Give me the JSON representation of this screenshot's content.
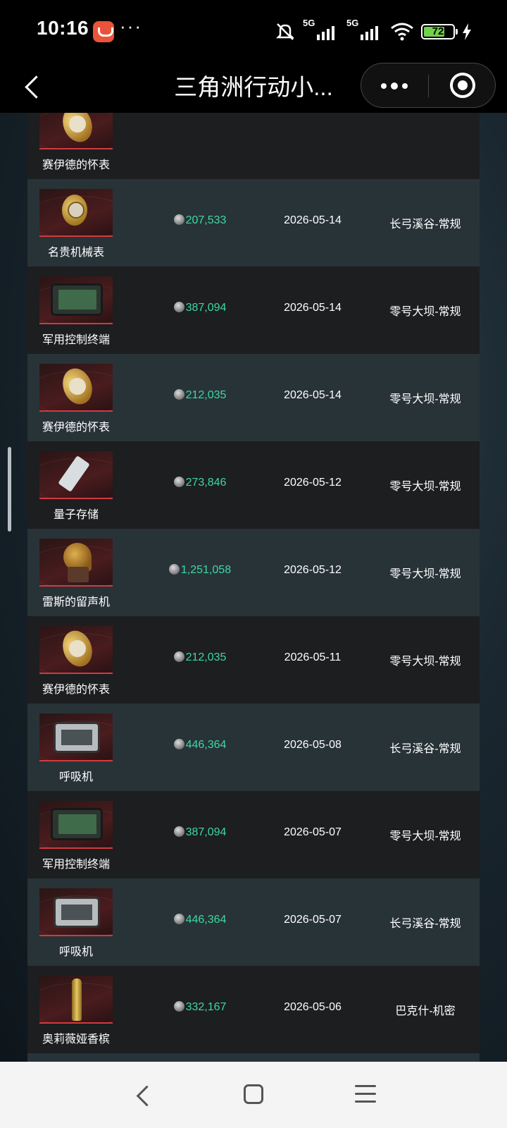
{
  "status_bar": {
    "time": "10:16",
    "dots": "···",
    "signal1_label": "5G",
    "signal2_label": "5G",
    "battery_level": "72",
    "battery_fraction": 0.72
  },
  "title_bar": {
    "title": "三角洲行动小..."
  },
  "icons": {
    "back": "chevron-left-icon",
    "more": "more-dots-icon",
    "close": "target-close-icon",
    "coin": "coin-icon"
  },
  "colors": {
    "price_green": "#3ed9a0",
    "row_dark": "#1c1e20",
    "row_light": "#283338",
    "thumb_accent": "#d23a3e"
  },
  "records": [
    {
      "name": "赛伊德的怀表",
      "price": "",
      "date": "",
      "map": "",
      "art": "pocketwatch"
    },
    {
      "name": "名贵机械表",
      "price": "207,533",
      "date": "2026-05-14",
      "map": "长弓溪谷-常规",
      "art": "watch"
    },
    {
      "name": "军用控制终端",
      "price": "387,094",
      "date": "2026-05-14",
      "map": "零号大坝-常规",
      "art": "terminal"
    },
    {
      "name": "赛伊德的怀表",
      "price": "212,035",
      "date": "2026-05-14",
      "map": "零号大坝-常规",
      "art": "pocketwatch"
    },
    {
      "name": "量子存储",
      "price": "273,846",
      "date": "2026-05-12",
      "map": "零号大坝-常规",
      "art": "quantum"
    },
    {
      "name": "雷斯的留声机",
      "price": "1,251,058",
      "date": "2026-05-12",
      "map": "零号大坝-常规",
      "art": "gramophone"
    },
    {
      "name": "赛伊德的怀表",
      "price": "212,035",
      "date": "2026-05-11",
      "map": "零号大坝-常规",
      "art": "pocketwatch"
    },
    {
      "name": "呼吸机",
      "price": "446,364",
      "date": "2026-05-08",
      "map": "长弓溪谷-常规",
      "art": "respirator"
    },
    {
      "name": "军用控制终端",
      "price": "387,094",
      "date": "2026-05-07",
      "map": "零号大坝-常规",
      "art": "terminal"
    },
    {
      "name": "呼吸机",
      "price": "446,364",
      "date": "2026-05-07",
      "map": "长弓溪谷-常规",
      "art": "respirator"
    },
    {
      "name": "奥莉薇娅香槟",
      "price": "332,167",
      "date": "2026-05-06",
      "map": "巴克什-机密",
      "art": "champagne"
    },
    {
      "name": "",
      "price": "",
      "date": "",
      "map": "",
      "art": "caviar"
    }
  ]
}
